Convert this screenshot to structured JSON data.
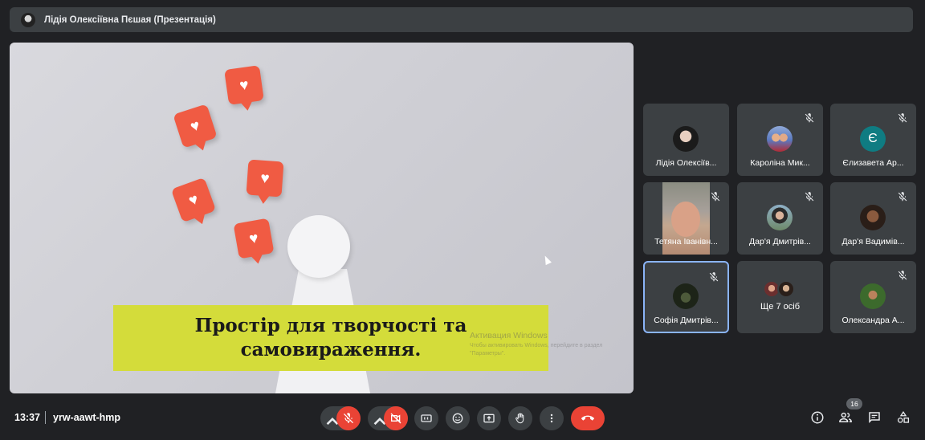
{
  "header": {
    "presenter_title": "Лідія Олексіївна Пєшая (Презентація)"
  },
  "presentation": {
    "caption": "Простір для творчості та\nсамовираження.",
    "watermark_title": "Активация Windows",
    "watermark_text": "Чтобы активировать Windows, перейдите в раздел \"Параметры\"."
  },
  "participants": [
    {
      "name": "Лідія Олексіїв...",
      "muted": false,
      "avatar": "photo-dark-hair"
    },
    {
      "name": "Кароліна Мик...",
      "muted": true,
      "avatar": "photo-group"
    },
    {
      "name": "Єлизавета Ар...",
      "muted": true,
      "avatar_letter": "Є",
      "avatar_color": "#0f7c82"
    },
    {
      "name": "Тетяна Іванівн...",
      "muted": true,
      "video": true
    },
    {
      "name": "Дар'я Дмитрів...",
      "muted": true,
      "avatar": "photo-outdoor"
    },
    {
      "name": "Дар'я Вадимів...",
      "muted": true,
      "avatar": "photo-dark"
    },
    {
      "name": "Софія Дмитрів...",
      "muted": true,
      "avatar": "photo-plant",
      "active_speaker": true
    },
    {
      "name": "Ще 7 осіб",
      "more": true
    },
    {
      "name": "Олександра А...",
      "muted": true,
      "avatar": "photo-green"
    }
  ],
  "footer": {
    "time": "13:37",
    "meeting_code": "yrw-aawt-hmp",
    "participants_count": "16"
  },
  "colors": {
    "accent": "#8ab4f8",
    "danger": "#ea4335",
    "caption_bg": "#d4dc3a",
    "heart": "#f05b43"
  }
}
